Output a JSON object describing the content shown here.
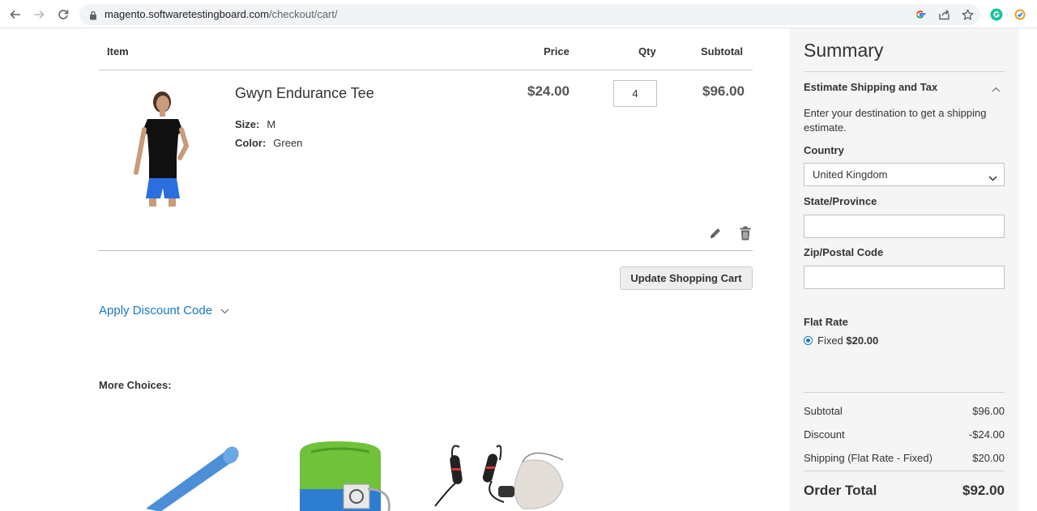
{
  "browser": {
    "url_host": "magento.softwaretestingboard.com",
    "url_path": "/checkout/cart/"
  },
  "cart": {
    "headers": {
      "item": "Item",
      "price": "Price",
      "qty": "Qty",
      "subtotal": "Subtotal"
    },
    "items": [
      {
        "name": "Gwyn Endurance Tee",
        "options": [
          {
            "label": "Size:",
            "value": "M"
          },
          {
            "label": "Color:",
            "value": "Green"
          }
        ],
        "price": "$24.00",
        "qty": "4",
        "subtotal": "$96.00"
      }
    ],
    "update_button": "Update Shopping Cart",
    "discount_link": "Apply Discount Code",
    "more_choices": "More Choices:"
  },
  "summary": {
    "title": "Summary",
    "estimate_title": "Estimate Shipping and Tax",
    "estimate_note": "Enter your destination to get a shipping estimate.",
    "country_label": "Country",
    "country_value": "United Kingdom",
    "state_label": "State/Province",
    "zip_label": "Zip/Postal Code",
    "flat_rate_label": "Flat Rate",
    "fixed_label": "Fixed",
    "fixed_price": "$20.00",
    "totals": [
      {
        "label": "Subtotal",
        "value": "$96.00"
      },
      {
        "label": "Discount",
        "value": "-$24.00"
      },
      {
        "label": "Shipping (Flat Rate - Fixed)",
        "value": "$20.00"
      }
    ],
    "order_total_label": "Order Total",
    "order_total_value": "$92.00"
  },
  "colors": {
    "link": "#1979c3",
    "summary_bg": "#f5f5f5"
  }
}
